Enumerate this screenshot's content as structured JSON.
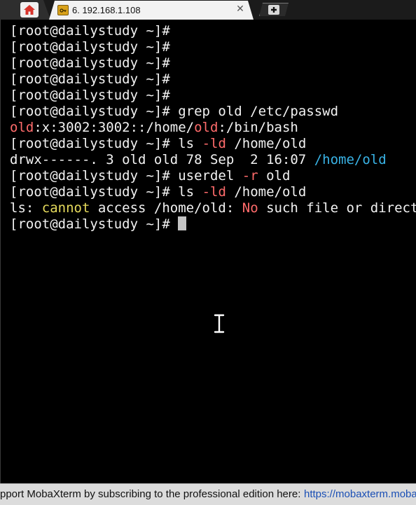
{
  "tabs": {
    "home_icon": "home-icon",
    "session": {
      "icon": "key-icon",
      "title": "6. 192.168.1.108",
      "close_label": "✕"
    },
    "new_tab_label": "+"
  },
  "terminal": {
    "prompt": "[root@dailystudy ~]#",
    "lines": {
      "l6_cmd": "grep old /etc/passwd",
      "l7_a": "old",
      "l7_b": ":x:3002:3002::/home/",
      "l7_c": "old",
      "l7_d": ":/bin/bash",
      "l8_cmd": "ls ",
      "l8_opt": "-ld",
      "l8_arg": " /home/old",
      "l9_a": "drwx------. 3 old old 78 Sep  2 16:07 ",
      "l9_b": "/home/old",
      "l10_cmd": "userdel ",
      "l10_opt": "-r",
      "l10_arg": " old",
      "l11_cmd": "ls ",
      "l11_opt": "-ld",
      "l11_arg": " /home/old",
      "l12_a": "ls: ",
      "l12_b": "cannot",
      "l12_c": " access /home/old: ",
      "l12_d": "No",
      "l12_e": " such file or direct"
    },
    "colors": {
      "red": "#ff6b6b",
      "blue": "#39b3e6",
      "yellow": "#e6db5c"
    }
  },
  "footer": {
    "text": "pport MobaXterm by subscribing to the professional edition here:",
    "link": "https://mobaxterm.moba"
  }
}
